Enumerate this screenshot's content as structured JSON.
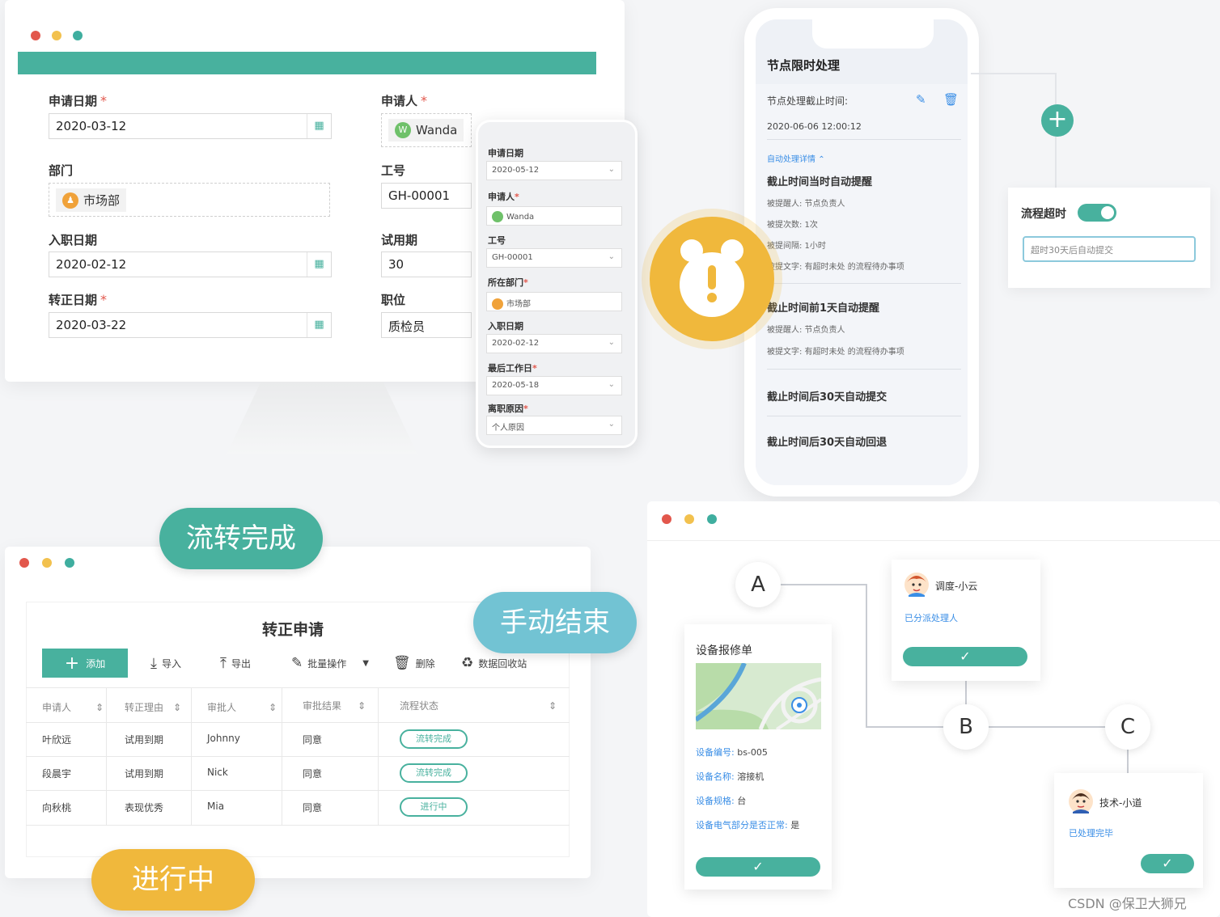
{
  "form": {
    "apply_date_label": "申请日期",
    "apply_date_value": "2020-03-12",
    "applicant_label": "申请人",
    "applicant_value": "Wanda",
    "applicant_avatar": "W",
    "dept_label": "部门",
    "dept_value": "市场部",
    "empno_label": "工号",
    "empno_value": "GH-00001",
    "join_date_label": "入职日期",
    "join_date_value": "2020-02-12",
    "probation_label": "试用期",
    "probation_value": "30",
    "regular_date_label": "转正日期",
    "regular_date_value": "2020-03-22",
    "position_label": "职位",
    "position_value": "质检员",
    "required_mark": "*"
  },
  "mobile_form": {
    "apply_date_label": "申请日期",
    "apply_date_value": "2020-05-12",
    "applicant_label": "申请人",
    "applicant_value": "Wanda",
    "empno_label": "工号",
    "empno_value": "GH-00001",
    "dept_label": "所在部门",
    "dept_value": "市场部",
    "join_date_label": "入职日期",
    "join_date_value": "2020-02-12",
    "last_day_label": "最后工作日",
    "last_day_value": "2020-05-18",
    "reason_label": "离职原因",
    "reason_value": "个人原因"
  },
  "deadline": {
    "title": "节点限时处理",
    "deadline_label": "节点处理截止时间:",
    "deadline_value": "2020-06-06 12:00:12",
    "detail_toggle": "自动处理详情",
    "rule1_title": "截止时间当时自动提醒",
    "rule1_remind_who": "被提醒人:  节点负责人",
    "rule1_times": "被提次数:  1次",
    "rule1_interval": "被提间隔:  1小时",
    "rule1_text": "被提文字:  有超时未处 的流程待办事项",
    "rule2_title": "截止时间前1天自动提醒",
    "rule2_remind_who": "被提醒人:  节点负责人",
    "rule2_text": "被提文字:  有超时未处 的流程待办事项",
    "rule3_title": "截止时间后30天自动提交",
    "rule4_title": "截止时间后30天自动回退"
  },
  "timeout": {
    "label": "流程超时",
    "enabled": true,
    "input_value": "超时30天后自动提交"
  },
  "table": {
    "title": "转正申请",
    "toolbar": {
      "add": "添加",
      "import": "导入",
      "export": "导出",
      "batch": "批量操作",
      "delete": "删除",
      "recycle": "数据回收站"
    },
    "headers": [
      "申请人",
      "转正理由",
      "审批人",
      "审批结果",
      "流程状态"
    ],
    "rows": [
      {
        "applicant": "叶欣远",
        "reason": "试用到期",
        "approver": "Johnny",
        "result": "同意",
        "status": "流转完成"
      },
      {
        "applicant": "段晨宇",
        "reason": "试用到期",
        "approver": "Nick",
        "result": "同意",
        "status": "流转完成"
      },
      {
        "applicant": "向秋桃",
        "reason": "表现优秀",
        "approver": "Mia",
        "result": "同意",
        "status": "进行中"
      }
    ]
  },
  "badges": {
    "done": "流转完成",
    "manual_end": "手动结束",
    "in_progress": "进行中"
  },
  "flow": {
    "node_a": "A",
    "node_b": "B",
    "node_c": "C",
    "repair_title": "设备报修单",
    "field_no": "设备编号:",
    "value_no": "bs-005",
    "field_name": "设备名称:",
    "value_name": "溶接机",
    "field_spec": "设备规格:",
    "value_spec": "台",
    "field_electric": "设备电气部分是否正常:",
    "value_electric": "是",
    "dispatcher_name": "调度-小云",
    "dispatcher_status": "已分派处理人",
    "tech_name": "技术-小道",
    "tech_status": "已处理完毕"
  },
  "watermark": "CSDN @保卫大狮兄",
  "colors": {
    "accent": "#48b19e",
    "yellow": "#f0b83c",
    "sky": "#72c3d3",
    "link": "#3a8ee6"
  }
}
